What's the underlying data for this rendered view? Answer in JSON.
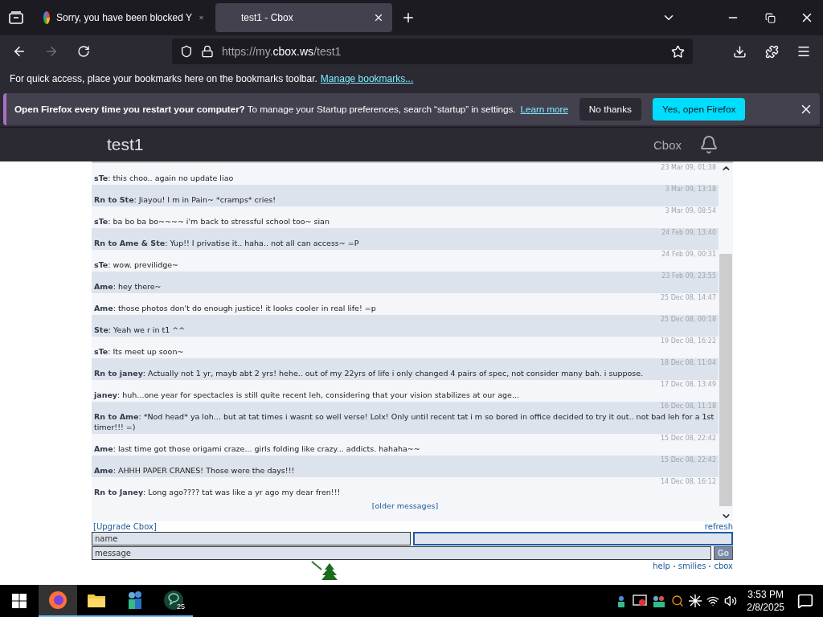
{
  "browser": {
    "tabs": [
      {
        "title": "Sorry, you have been blocked Y",
        "selected": false
      },
      {
        "title": "test1 - Cbox",
        "selected": true
      }
    ],
    "url": "https://my.**cbox.ws**/test1"
  },
  "bookmarks_bar": {
    "text": "For quick access, place your bookmarks here on the bookmarks toolbar.",
    "link": "Manage bookmarks..."
  },
  "notification": {
    "message": "**Open Firefox every time you restart your computer?** To manage your Startup preferences, search “startup” in settings.",
    "link": "Learn more",
    "buttons": [
      {
        "label": "No thanks",
        "kind": "secondary"
      },
      {
        "label": "Yes, open Firefox",
        "kind": "primary"
      }
    ]
  },
  "page_header": {
    "title": "test1",
    "brand": "Cbox"
  },
  "chat": {
    "messages": [
      {
        "time": "23 Mar 09, 01:38",
        "text": "**sTe**: this choo.. again no update liao"
      },
      {
        "time": "3 Mar 09, 13:18",
        "text": "**Rn to Ste**: Jiayou! I m in Pain~ ",
        "literal": "*cramps* cries!"
      },
      {
        "time": "3 Mar 09, 08:54",
        "text": "**sTe**: ba bo ba bo~~~~ i'm back to stressful school too~ sian"
      },
      {
        "time": "24 Feb 09, 13:40",
        "text": "**Rn to Ame & Ste**: Yup!! I privatise it.. haha.. not all can access~ =P"
      },
      {
        "time": "24 Feb 09, 00:31",
        "text": "**sTe**: wow. previlidge~"
      },
      {
        "time": "23 Feb 09, 23:55",
        "text": "**Ame**: hey there~"
      },
      {
        "time": "25 Dec 08, 14:47",
        "text": "**Ame**: those photos don't do enough justice! it looks cooler in real life! =p"
      },
      {
        "time": "25 Dec 08, 00:18",
        "text": "**Ste**: Yeah we r in t1 ^^"
      },
      {
        "time": "19 Dec 08, 16:22",
        "text": "**sTe**: Its meet up soon~"
      },
      {
        "time": "18 Dec 08, 11:04",
        "text": "**Rn to janey**: Actually not 1 yr, mayb abt 2 yrs! hehe.. out of my 22yrs of life i only changed 4 pairs of spec, not consider many bah. i suppose."
      },
      {
        "time": "17 Dec 08, 13:49",
        "text": "**janey**: huh...one year for spectacles is still quite recent leh, considering that your vision stabilizes at our age..."
      },
      {
        "time": "16 Dec 08, 11:18",
        "text": "**Rn to Ame**: ",
        "literal": "*Nod head* ya loh... but at tat times i wasnt so well verse! Lolx! Only until recent tat i m so bored in office decided to try it out.. not bad leh for a 1st timer!!! =)"
      },
      {
        "time": "15 Dec 08, 22:42",
        "text": "**Ame**: last time got those origami craze... girls folding like crazy... addicts. hahaha~~"
      },
      {
        "time": "15 Dec 08, 22:42",
        "text": "**Ame**: AHHH PAPER CRANES! Those were the days!!!"
      },
      {
        "time": "14 Dec 08, 16:12",
        "text": "**Rn to Janey**: Long ago???? tat was like a yr ago my dear fren!!!"
      }
    ],
    "older_link": "[older messages]",
    "upgrade_link": "[Upgrade Cbox]",
    "refresh_link": "refresh",
    "name_placeholder": "name",
    "message_placeholder": "message",
    "submit": "Go",
    "footer_links": [
      "help",
      "smilies",
      "cbox"
    ]
  },
  "taskbar": {
    "apps": [
      {
        "kind": "firefox",
        "selected": true
      },
      {
        "kind": "folder",
        "selected": false
      },
      {
        "kind": "people",
        "selected": false
      },
      {
        "kind": "chat",
        "selected": false,
        "badge": "25"
      }
    ],
    "time": "3:53 PM",
    "date": "2/8/2025"
  }
}
